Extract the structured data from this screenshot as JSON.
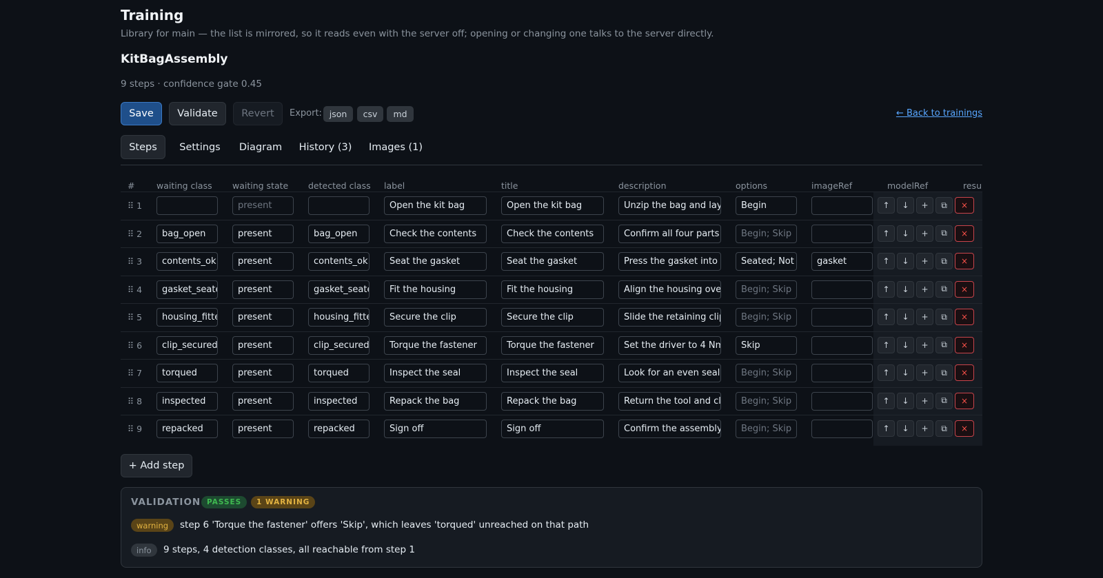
{
  "header": {
    "title": "Training",
    "subtitle": "Library for main — the list is mirrored, so it reads even with the server off; opening or changing one talks to the server directly.",
    "training_name": "KitBagAssembly",
    "meta": "9 steps · confidence gate 0.45"
  },
  "toolbar": {
    "save_label": "Save",
    "validate_label": "Validate",
    "revert_label": "Revert",
    "export_label": "Export:",
    "export_formats": [
      "json",
      "csv",
      "md"
    ],
    "back_link": "← Back to trainings"
  },
  "tabs": [
    {
      "label": "Steps",
      "active": true
    },
    {
      "label": "Settings",
      "active": false
    },
    {
      "label": "Diagram",
      "active": false
    },
    {
      "label": "History (3)",
      "active": false
    },
    {
      "label": "Images (1)",
      "active": false
    }
  ],
  "table": {
    "columns": [
      "#",
      "waiting class",
      "waiting state",
      "detected class",
      "label",
      "title",
      "description",
      "options",
      "imageRef",
      "modelRef",
      "resul"
    ],
    "placeholders": {
      "waiting_state": "present",
      "options": "Begin; Skip"
    },
    "rows": [
      {
        "num": "1",
        "waiting_class": "",
        "waiting_state": "",
        "detected_class": "",
        "label": "Open the kit bag",
        "title": "Open the kit bag",
        "description": "Unzip the bag and lay",
        "options": "Begin",
        "imageRef": ""
      },
      {
        "num": "2",
        "waiting_class": "bag_open",
        "waiting_state": "present",
        "detected_class": "bag_open",
        "label": "Check the contents",
        "title": "Check the contents",
        "description": "Confirm all four parts a",
        "options": "",
        "imageRef": ""
      },
      {
        "num": "3",
        "waiting_class": "contents_ok",
        "waiting_state": "present",
        "detected_class": "contents_ok",
        "label": "Seat the gasket",
        "title": "Seat the gasket",
        "description": "Press the gasket into tl",
        "options": "Seated; Not",
        "imageRef": "gasket"
      },
      {
        "num": "4",
        "waiting_class": "gasket_seate",
        "waiting_state": "present",
        "detected_class": "gasket_seate",
        "label": "Fit the housing",
        "title": "Fit the housing",
        "description": "Align the housing over",
        "options": "",
        "imageRef": ""
      },
      {
        "num": "5",
        "waiting_class": "housing_fitte",
        "waiting_state": "present",
        "detected_class": "housing_fitte",
        "label": "Secure the clip",
        "title": "Secure the clip",
        "description": "Slide the retaining clip",
        "options": "",
        "imageRef": ""
      },
      {
        "num": "6",
        "waiting_class": "clip_secured",
        "waiting_state": "present",
        "detected_class": "clip_secured",
        "label": "Torque the fastener",
        "title": "Torque the fastener",
        "description": "Set the driver to 4 Nm",
        "options": "Skip",
        "imageRef": ""
      },
      {
        "num": "7",
        "waiting_class": "torqued",
        "waiting_state": "present",
        "detected_class": "torqued",
        "label": "Inspect the seal",
        "title": "Inspect the seal",
        "description": "Look for an even seal l",
        "options": "",
        "imageRef": ""
      },
      {
        "num": "8",
        "waiting_class": "inspected",
        "waiting_state": "present",
        "detected_class": "inspected",
        "label": "Repack the bag",
        "title": "Repack the bag",
        "description": "Return the tool and clc",
        "options": "",
        "imageRef": ""
      },
      {
        "num": "9",
        "waiting_class": "repacked",
        "waiting_state": "present",
        "detected_class": "repacked",
        "label": "Sign off",
        "title": "Sign off",
        "description": "Confirm the assembly",
        "options": "",
        "imageRef": ""
      }
    ],
    "action_icons": [
      "↑",
      "↓",
      "+",
      "⧉",
      "×"
    ],
    "action_icon_names": [
      "arrow-up-icon",
      "arrow-down-icon",
      "plus-icon",
      "copy-icon",
      "close-icon"
    ],
    "add_step_label": "+ Add step"
  },
  "validation": {
    "title": "VALIDATION",
    "badges": {
      "passes": "PASSES",
      "warnings": "1 WARNING"
    },
    "messages": [
      {
        "level": "warning",
        "text": "step 6 'Torque the fastener' offers 'Skip', which leaves 'torqued' unreached on that path"
      },
      {
        "level": "info",
        "text": "9 steps, 4 detection classes, all reachable from step 1"
      }
    ]
  },
  "colors": {
    "background": "#0d1117",
    "accent": "#1f4f8a",
    "link": "#58a6ff",
    "pass": "#3fb950",
    "warn": "#e3b341",
    "danger": "#f85149"
  }
}
